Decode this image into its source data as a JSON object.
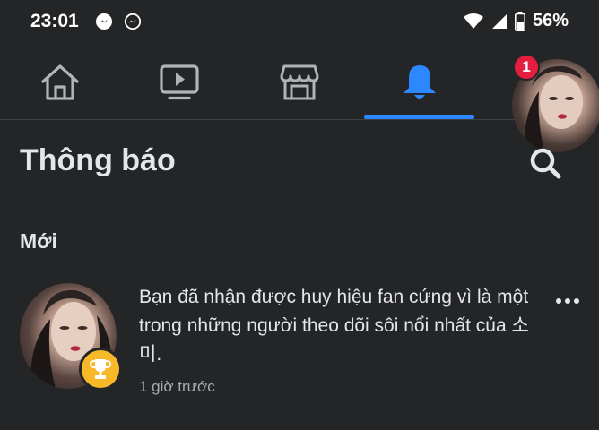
{
  "status_bar": {
    "time": "23:01",
    "battery": "56%",
    "icons": [
      "messenger-icon",
      "messenger-icon",
      "wifi-icon",
      "signal-icon",
      "battery-icon"
    ]
  },
  "nav": {
    "tabs": [
      {
        "name": "home",
        "icon": "home-icon"
      },
      {
        "name": "watch",
        "icon": "video-icon"
      },
      {
        "name": "marketplace",
        "icon": "store-icon"
      },
      {
        "name": "notifications",
        "icon": "bell-icon",
        "active": true
      },
      {
        "name": "profile",
        "icon": "avatar"
      }
    ],
    "badge_count": "1",
    "accent": "#2d88ff"
  },
  "page": {
    "title": "Thông báo",
    "section_new": "Mới"
  },
  "notifications": [
    {
      "text_pre": "Bạn đã nhận được huy hiệu fan cứng vì là một trong những người theo dõi sôi nổi nhất của ",
      "name": "소미",
      "text_post": ".",
      "time": "1 giờ trước",
      "badge_icon": "trophy-icon"
    }
  ]
}
